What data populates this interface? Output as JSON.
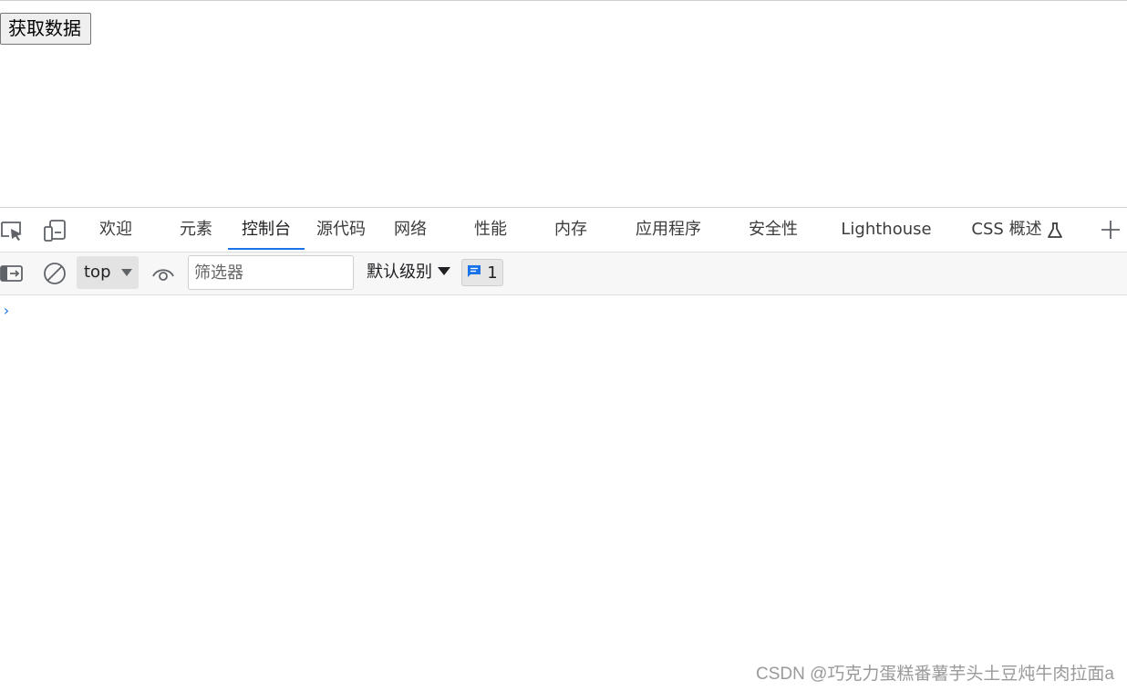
{
  "page": {
    "button_label": "获取数据"
  },
  "devtools": {
    "tabs": [
      {
        "label": "欢迎"
      },
      {
        "label": "元素"
      },
      {
        "label": "控制台",
        "active": true
      },
      {
        "label": "源代码"
      },
      {
        "label": "网络"
      },
      {
        "label": "性能"
      },
      {
        "label": "内存"
      },
      {
        "label": "应用程序"
      },
      {
        "label": "安全性"
      },
      {
        "label": "Lighthouse"
      },
      {
        "label": "CSS 概述"
      }
    ],
    "accent_color": "#1a73e8",
    "icons": {
      "inspect": "inspect-element-icon",
      "device": "device-toolbar-icon",
      "experimental": "flask-icon",
      "add": "plus-icon"
    }
  },
  "console": {
    "context": "top",
    "filter_placeholder": "筛选器",
    "level_label": "默认级别",
    "issues_count": "1",
    "prompt_symbol": "›",
    "icons": {
      "sidebar": "sidebar-toggle-icon",
      "clear": "clear-console-icon",
      "live_expression": "eye-icon",
      "issues": "message-icon"
    }
  },
  "watermark": "CSDN @巧克力蛋糕番薯芋头土豆炖牛肉拉面a"
}
